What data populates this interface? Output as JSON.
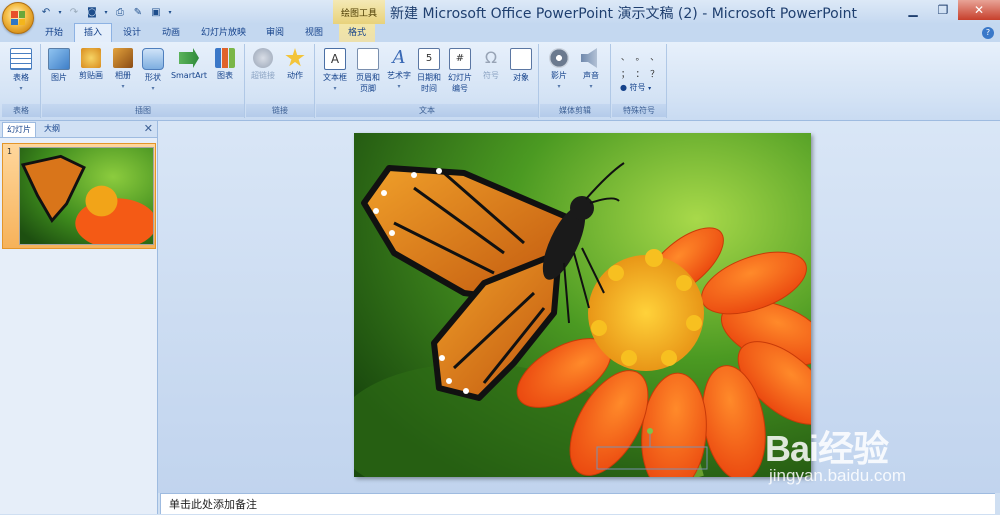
{
  "window": {
    "title": "新建 Microsoft Office PowerPoint 演示文稿 (2) - Microsoft PowerPoint",
    "context_tag": "绘图工具"
  },
  "tabs": [
    {
      "label": "开始",
      "active": false
    },
    {
      "label": "插入",
      "active": true
    },
    {
      "label": "设计",
      "active": false
    },
    {
      "label": "动画",
      "active": false
    },
    {
      "label": "幻灯片放映",
      "active": false
    },
    {
      "label": "审阅",
      "active": false
    },
    {
      "label": "视图",
      "active": false
    },
    {
      "label": "格式",
      "active": false,
      "contextual": true
    }
  ],
  "ribbon": {
    "groups": {
      "table": "表格",
      "illustrations": "插图",
      "links": "链接",
      "text": "文本",
      "media": "媒体剪辑",
      "symbols": "特殊符号"
    },
    "buttons": {
      "table": "表格",
      "picture": "图片",
      "clipart": "剪贴画",
      "album": "相册",
      "shapes": "形状",
      "smartart": "SmartArt",
      "chart": "图表",
      "hyperlink": "超链接",
      "action": "动作",
      "textbox": "文本框",
      "header_footer_1": "页眉和",
      "header_footer_2": "页脚",
      "wordart": "艺术字",
      "datetime_1": "日期和",
      "datetime_2": "时间",
      "slide_number_1": "幻灯片",
      "slide_number_2": "编号",
      "symbol": "符号",
      "object": "对象",
      "movie": "影片",
      "sound": "声音",
      "special_symbol": "符号"
    },
    "symbol_glyphs": [
      "、",
      "。",
      "、",
      "；",
      "：",
      "？"
    ]
  },
  "panel": {
    "tab_slides": "幻灯片",
    "tab_outline": "大纲",
    "slide_number": "1"
  },
  "notes_placeholder": "单击此处添加备注",
  "watermark": {
    "brand": "Bai经验",
    "url": "jingyan.baidu.com"
  }
}
